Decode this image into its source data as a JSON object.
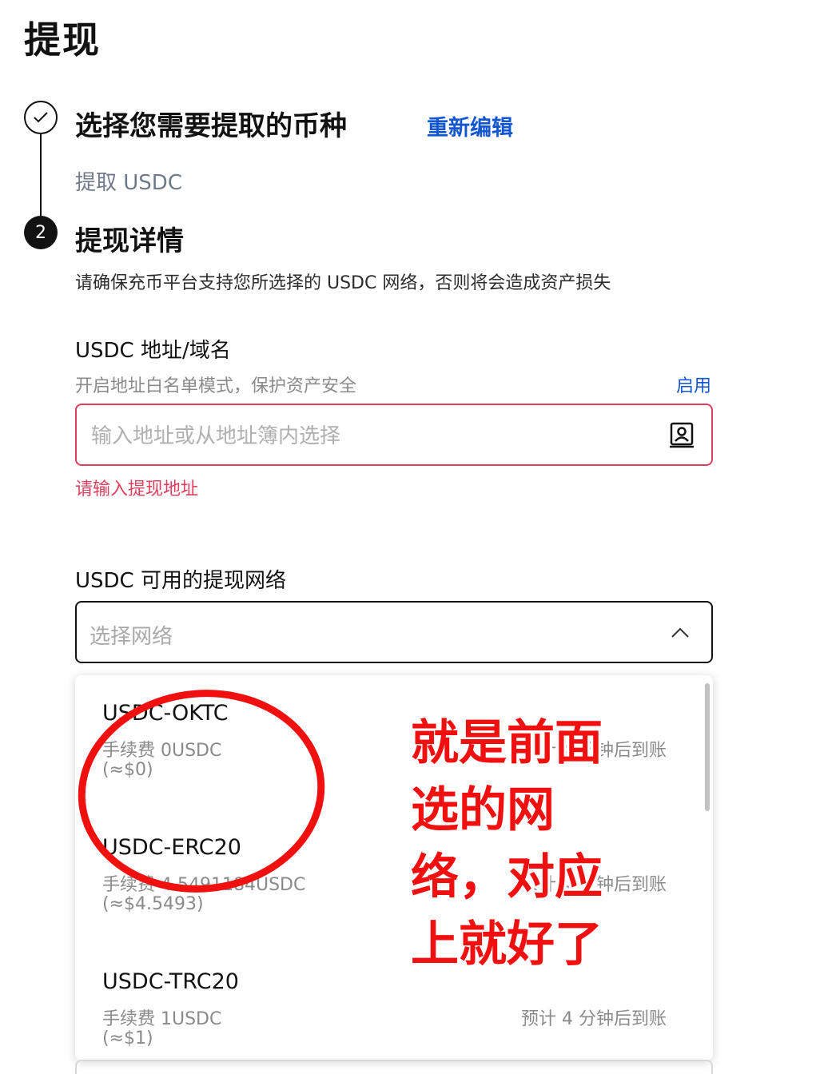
{
  "page": {
    "title": "提现"
  },
  "step1": {
    "title": "选择您需要提取的币种",
    "reedit": "重新编辑",
    "summary": "提取 USDC"
  },
  "step2": {
    "number": "2",
    "title": "提现详情",
    "notice": "请确保充币平台支持您所选择的 USDC 网络，否则将会造成资产损失"
  },
  "address": {
    "label": "USDC 地址/域名",
    "whitelist_text": "开启地址白名单模式，保护资产安全",
    "enable_link": "启用",
    "placeholder": "输入地址或从地址簿内选择",
    "value": "",
    "error": "请输入提现地址",
    "icon": "address-book-icon"
  },
  "network": {
    "label": "USDC 可用的提现网络",
    "placeholder": "选择网络",
    "icon": "chevron-up-icon",
    "options": [
      {
        "name": "USDC-OKTC",
        "fee": "手续费 0USDC",
        "usd": "(≈$0)",
        "eta": "预计 4 分钟后到账"
      },
      {
        "name": "USDC-ERC20",
        "fee": "手续费 4.5491184USDC",
        "usd": "(≈$4.5493)",
        "eta": "预计 4 分钟后到账"
      },
      {
        "name": "USDC-TRC20",
        "fee": "手续费 1USDC",
        "usd": "(≈$1)",
        "eta": "预计 4 分钟后到账"
      }
    ]
  },
  "annotation": {
    "lines": [
      "就是前面",
      "选的网",
      "络，对应",
      "上就好了"
    ],
    "color": "#f01010"
  },
  "colors": {
    "accent_link": "#1356d2",
    "error": "#e0405e",
    "text": "#121212"
  }
}
